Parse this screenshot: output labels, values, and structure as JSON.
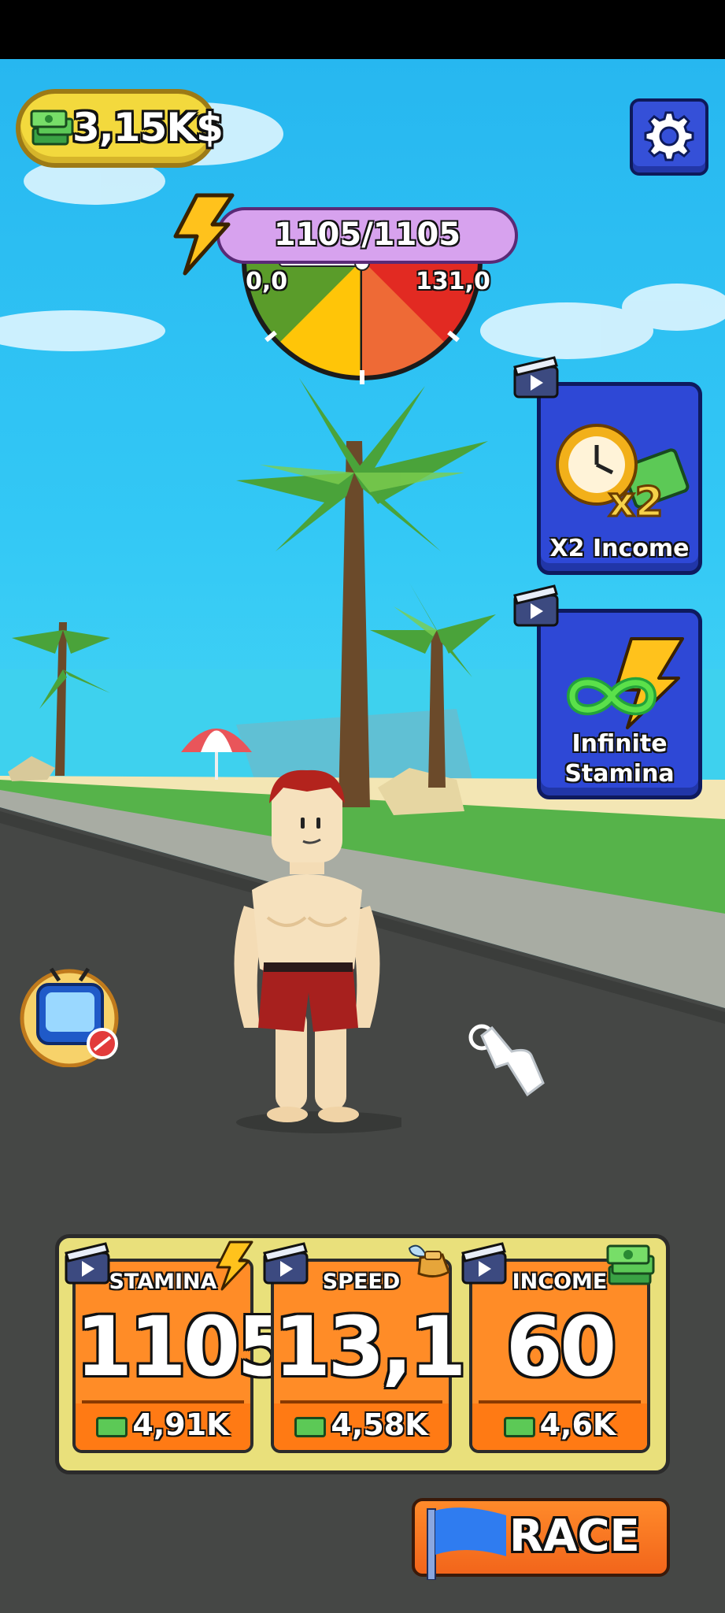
{
  "hud": {
    "money": "3,15K$",
    "stamina_current": "1105/1105",
    "gauge_min": "0,0",
    "gauge_max": "131,0"
  },
  "boosters": [
    {
      "label_line1": "X2 Income",
      "label_line2": "",
      "icon": "clock-x2-cash-icon"
    },
    {
      "label_line1": "Infinite",
      "label_line2": "Stamina",
      "icon": "infinity-lightning-icon"
    }
  ],
  "upgrades": [
    {
      "title": "STAMINA",
      "value": "1105",
      "price": "4,91K",
      "icon": "lightning-icon"
    },
    {
      "title": "SPEED",
      "value": "13,1",
      "price": "4,58K",
      "icon": "winged-shoe-icon"
    },
    {
      "title": "INCOME",
      "value": "60",
      "price": "4,6K",
      "icon": "cash-stack-icon"
    }
  ],
  "race_label": "RACE",
  "colors": {
    "accent_orange": "#ff8c27",
    "booster_blue": "#2e48d6",
    "money_yellow": "#f3d93d",
    "stamina_purple": "#d7a2ee"
  }
}
